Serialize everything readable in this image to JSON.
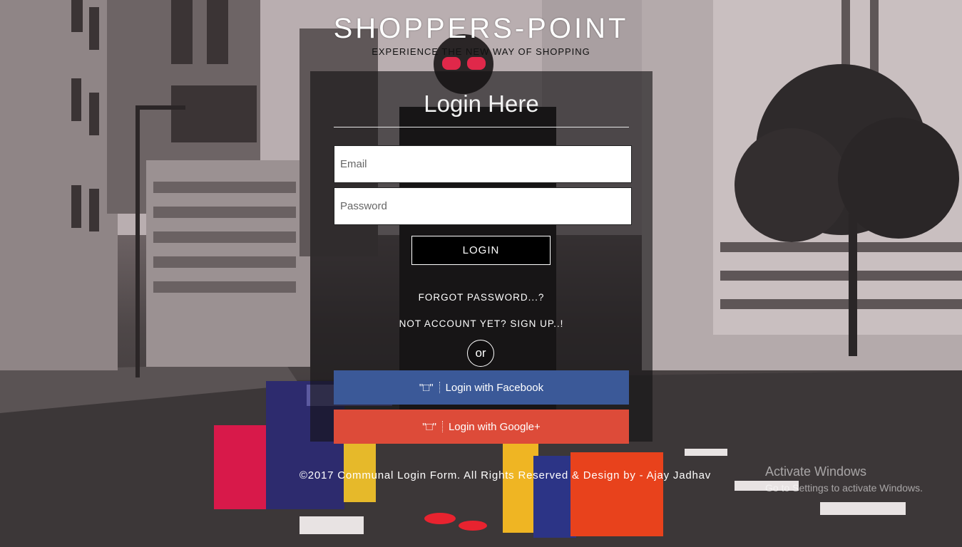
{
  "header": {
    "brand": "SHOPPERS-POINT",
    "tagline": "EXPERIENCE THE NEW WAY OF SHOPPING"
  },
  "login": {
    "title": "Login Here",
    "email_placeholder": "Email",
    "password_placeholder": "Password",
    "login_label": "LOGIN",
    "forgot_label": "FORGOT PASSWORD...?",
    "signup_label": "NOT ACCOUNT YET? SIGN UP..!",
    "or_label": "or",
    "facebook": {
      "icon_glyph": "\"□\"",
      "label": "Login with Facebook",
      "color": "#3b5998"
    },
    "google": {
      "icon_glyph": "\"□\"",
      "label": "Login with Google+",
      "color": "#dd4b39"
    }
  },
  "footer": {
    "text": "©2017 Communal Login Form. All Rights Reserved & Design by - Ajay Jadhav"
  },
  "watermark": {
    "title": "Activate Windows",
    "subtitle": "Go to Settings to activate Windows."
  }
}
